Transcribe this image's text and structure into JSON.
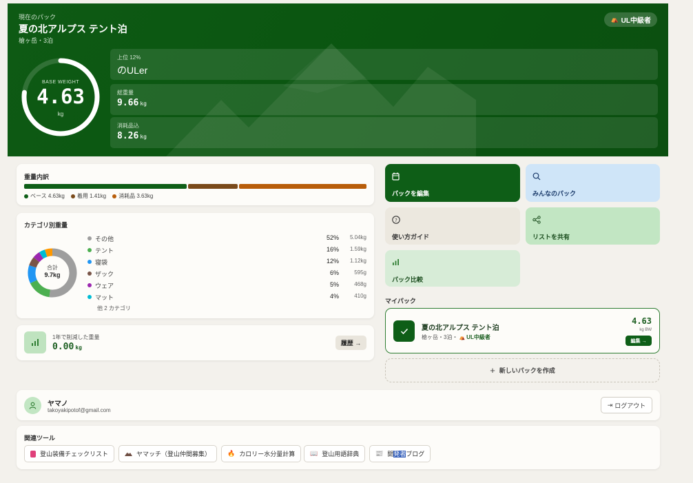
{
  "hero": {
    "label": "現在のパック",
    "title": "夏の北アルプス テント泊",
    "subtitle": "槍ヶ岳・3泊",
    "badge": "UL中級者",
    "base_weight_label": "BASE WEIGHT",
    "base_weight_value": "4.63",
    "base_weight_unit": "kg",
    "base_weight_ring_fraction": 0.77,
    "stats": {
      "rank_small": "上位 12%",
      "rank_big": "のULer",
      "total_label": "総重量",
      "total_value": "9.66",
      "consumables_label": "消耗品込",
      "consumables_value": "8.26",
      "unit": "kg"
    }
  },
  "weight_breakdown": {
    "title": "重量内訳",
    "segments": [
      {
        "label": "ベース 4.63kg",
        "value": 4.63,
        "color": "#0e5e17"
      },
      {
        "label": "着用 1.41kg",
        "value": 1.41,
        "color": "#7a4a1a"
      },
      {
        "label": "消耗品 3.63kg",
        "value": 3.63,
        "color": "#b85d0a"
      }
    ]
  },
  "category": {
    "title": "カテゴリ別重量",
    "total_label": "合計",
    "total_value": "9.7kg",
    "items": [
      {
        "name": "その他",
        "pct": "52%",
        "kg": "5.04kg",
        "share": 52,
        "color": "#9e9e9e"
      },
      {
        "name": "テント",
        "pct": "16%",
        "kg": "1.59kg",
        "share": 16,
        "color": "#4caf50"
      },
      {
        "name": "寝袋",
        "pct": "12%",
        "kg": "1.12kg",
        "share": 12,
        "color": "#2196f3"
      },
      {
        "name": "ザック",
        "pct": "6%",
        "kg": "595g",
        "share": 6,
        "color": "#795548"
      },
      {
        "name": "ウェア",
        "pct": "5%",
        "kg": "468g",
        "share": 5,
        "color": "#9c27b0"
      },
      {
        "name": "マット",
        "pct": "4%",
        "kg": "410g",
        "share": 4,
        "color": "#00bcd4"
      }
    ],
    "other_share": 5,
    "other_color": "#ff9800",
    "more": "他 2 カテゴリ"
  },
  "reduced": {
    "label": "1年で削減した重量",
    "value": "0.00",
    "unit": "kg",
    "history_button": "履歴 →"
  },
  "tiles": {
    "edit_pack": "パックを編集",
    "everyone_packs": "みんなのパック",
    "guide": "使い方ガイド",
    "share_list": "リストを共有",
    "compare": "パック比較"
  },
  "my_packs": {
    "title": "マイパック",
    "pack": {
      "name": "夏の北アルプス テント泊",
      "meta": "槍ヶ岳・3泊・",
      "badge": "UL中級者",
      "weight": "4.63",
      "unit": "kg BW",
      "edit_button": "編集 →"
    },
    "new_pack": "新しいパックを作成"
  },
  "user": {
    "name": "ヤマノ",
    "email": "takoyakipotof@gmail.com",
    "logout": "ログアウト"
  },
  "tools": {
    "title": "関連ツール",
    "items": [
      {
        "label": "登山装備チェックリスト",
        "icon": "backpack-icon"
      },
      {
        "label": "ヤマッチ（登山仲間募集）",
        "icon": "mountain-icon"
      },
      {
        "label": "カロリー水分量計算",
        "icon": "flame-icon"
      },
      {
        "label": "登山用語辞典",
        "icon": "book-icon"
      },
      {
        "label_pre": "開",
        "label_sel": "発者",
        "label_post": "ブログ",
        "icon": "newspaper-icon"
      }
    ]
  }
}
